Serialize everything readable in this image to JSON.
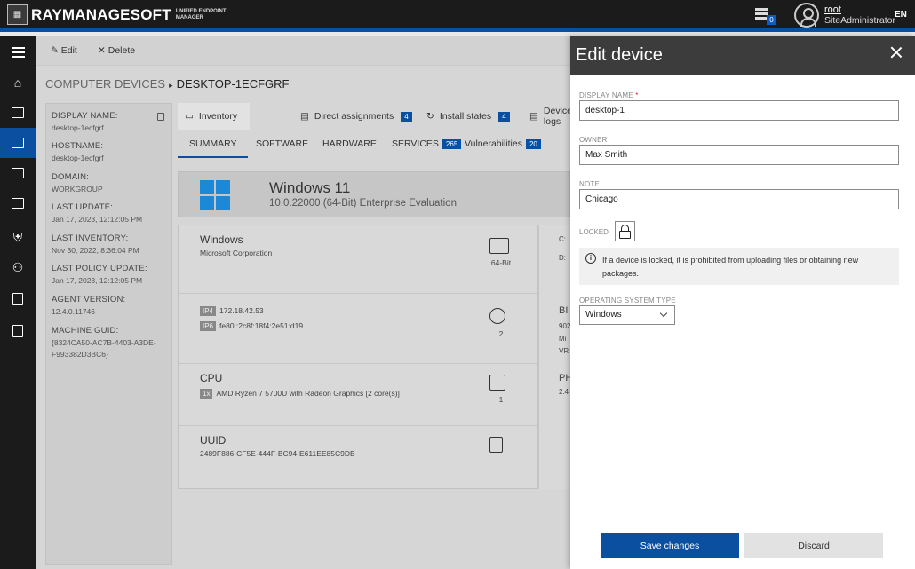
{
  "header": {
    "logo_text": "RAYMANAGESOFT",
    "logo_sub": "UNIFIED ENDPOINT MANAGER",
    "notification_count": "0",
    "user_name": "root",
    "user_role": "SiteAdministrator",
    "language": "EN"
  },
  "toolbar": {
    "edit_label": "Edit",
    "delete_label": "Delete"
  },
  "breadcrumb": {
    "parent": "COMPUTER DEVICES",
    "separator": "▸",
    "current": "DESKTOP-1ECFGRF"
  },
  "info": [
    {
      "label": "DISPLAY NAME:",
      "value": "desktop-1ecfgrf"
    },
    {
      "label": "HOSTNAME:",
      "value": "desktop-1ecfgrf"
    },
    {
      "label": "DOMAIN:",
      "value": "WORKGROUP"
    },
    {
      "label": "LAST UPDATE:",
      "value": "Jan 17, 2023, 12:12:05 PM"
    },
    {
      "label": "LAST INVENTORY:",
      "value": "Nov 30, 2022, 8:36:04 PM"
    },
    {
      "label": "LAST POLICY UPDATE:",
      "value": "Jan 17, 2023, 12:12:05 PM"
    },
    {
      "label": "AGENT VERSION:",
      "value": "12.4.0.11746"
    },
    {
      "label": "MACHINE GUID:",
      "value": "{8324CA50-AC7B-4403-A3DE-F993382D3BC6}"
    }
  ],
  "tabs": [
    {
      "label": "Inventory",
      "count": ""
    },
    {
      "label": "Direct assignments",
      "count": "4"
    },
    {
      "label": "Install states",
      "count": "4"
    },
    {
      "label": "Device logs",
      "count": ""
    }
  ],
  "subtabs": [
    {
      "label": "SUMMARY",
      "count": ""
    },
    {
      "label": "SOFTWARE",
      "count": ""
    },
    {
      "label": "HARDWARE",
      "count": ""
    },
    {
      "label": "SERVICES",
      "count": "265"
    },
    {
      "label": "Vulnerabilities",
      "count": "20"
    }
  ],
  "os": {
    "name": "Windows 11",
    "version": "10.0.22000 (64-Bit) Enterprise Evaluation"
  },
  "cards": {
    "windows": {
      "title": "Windows",
      "sub": "Microsoft Corporation",
      "icon_label": "64-Bit"
    },
    "network": {
      "ip4_tag": "IP4",
      "ip4": "172.18.42.53",
      "ip6_tag": "IP6",
      "ip6": "fe80::2c8f:18f4:2e51:d19",
      "icon_label": "2"
    },
    "cpu": {
      "title": "CPU",
      "tag": "1x",
      "sub": "AMD Ryzen 7 5700U with Radeon Graphics [2 core(s)]",
      "icon_label": "1"
    },
    "uuid": {
      "title": "UUID",
      "sub": "2489F886-CF5E-444F-BC94-E611EE85C9DB"
    },
    "right_fragments": [
      "C:",
      "D:",
      "BI",
      "902",
      "Mi",
      "VR",
      "PH",
      "2.4"
    ]
  },
  "panel": {
    "title": "Edit device",
    "display_name_label": "DISPLAY NAME",
    "required_mark": "*",
    "display_name_value": "desktop-1",
    "owner_label": "OWNER",
    "owner_value": "Max Smith",
    "note_label": "NOTE",
    "note_value": "Chicago",
    "locked_label": "LOCKED",
    "info_text": "If a device is locked, it is prohibited from uploading files or obtaining new packages.",
    "os_type_label": "OPERATING SYSTEM TYPE",
    "os_type_value": "Windows",
    "save_label": "Save changes",
    "discard_label": "Discard"
  },
  "colors": {
    "accent": "#0b4fa0",
    "topbar": "#1b1b1b",
    "panel_head": "#3c3c3c"
  }
}
